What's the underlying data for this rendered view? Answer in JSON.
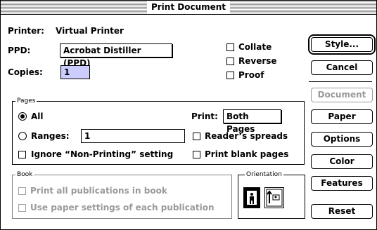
{
  "window": {
    "title": "Print Document"
  },
  "printer": {
    "label": "Printer:",
    "value": "Virtual Printer"
  },
  "ppd": {
    "label": "PPD:",
    "value": "Acrobat Distiller (PPD)"
  },
  "copies": {
    "label": "Copies:",
    "value": "1"
  },
  "options": {
    "collate": "Collate",
    "reverse": "Reverse",
    "proof": "Proof"
  },
  "pages": {
    "group_title": "Pages",
    "all_label": "All",
    "ranges_label": "Ranges:",
    "ranges_value": "1",
    "print_label": "Print:",
    "print_value": "Both Pages",
    "readers_spreads": "Reader’s spreads",
    "ignore_nonprinting": "Ignore “Non-Printing” setting",
    "print_blank": "Print blank pages"
  },
  "book": {
    "group_title": "Book",
    "print_all": "Print all publications in book",
    "use_paper": "Use paper settings of each publication"
  },
  "orientation": {
    "group_title": "Orientation",
    "portrait_icon": "portrait-orientation-icon",
    "landscape_icon": "landscape-orientation-icon"
  },
  "buttons": {
    "style": "Style...",
    "cancel": "Cancel",
    "document": "Document",
    "paper": "Paper",
    "options": "Options",
    "color": "Color",
    "features": "Features",
    "reset": "Reset"
  }
}
